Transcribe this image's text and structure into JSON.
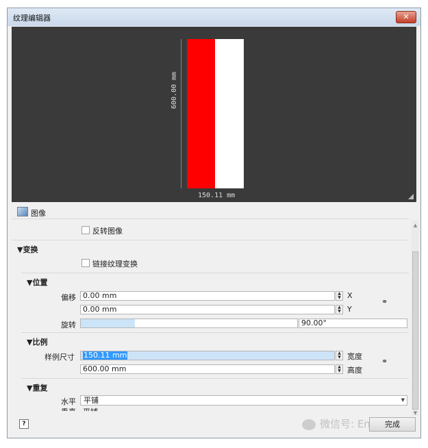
{
  "window": {
    "title": "纹理编辑器",
    "close_glyph": "✕"
  },
  "preview": {
    "height_dim": "600.00 mm",
    "width_dim": "150.11 mm",
    "colors": {
      "left_stripe": "#ff0000",
      "right_stripe": "#ffffff",
      "background": "#3a3a3a"
    }
  },
  "image_section": {
    "label": "图像",
    "invert_label": "反转图像"
  },
  "transform": {
    "header": "▼变换",
    "link_label": "链接纹理变换",
    "position": {
      "header": "▼位置",
      "offset_label": "偏移",
      "offset_x": "0.00 mm",
      "offset_y": "0.00 mm",
      "x_label": "X",
      "y_label": "Y",
      "rotation_label": "旋转",
      "rotation_value": "90.00°",
      "rotation_fraction": 0.25
    },
    "scale": {
      "header": "▼比例",
      "sample_size_label": "样例尺寸",
      "width_value": "150.11 mm",
      "height_value": "600.00 mm",
      "width_label": "宽度",
      "height_label": "高度"
    },
    "repeat": {
      "header": "▼重复",
      "horizontal_label": "水平",
      "horizontal_value": "平铺",
      "vertical_label": "垂直",
      "vertical_value": "平铺"
    }
  },
  "footer": {
    "help_label": "?",
    "done_label": "完成",
    "watermark": "微信号: Enoi"
  },
  "icons": {
    "link": "link-icon",
    "image": "image-icon"
  }
}
